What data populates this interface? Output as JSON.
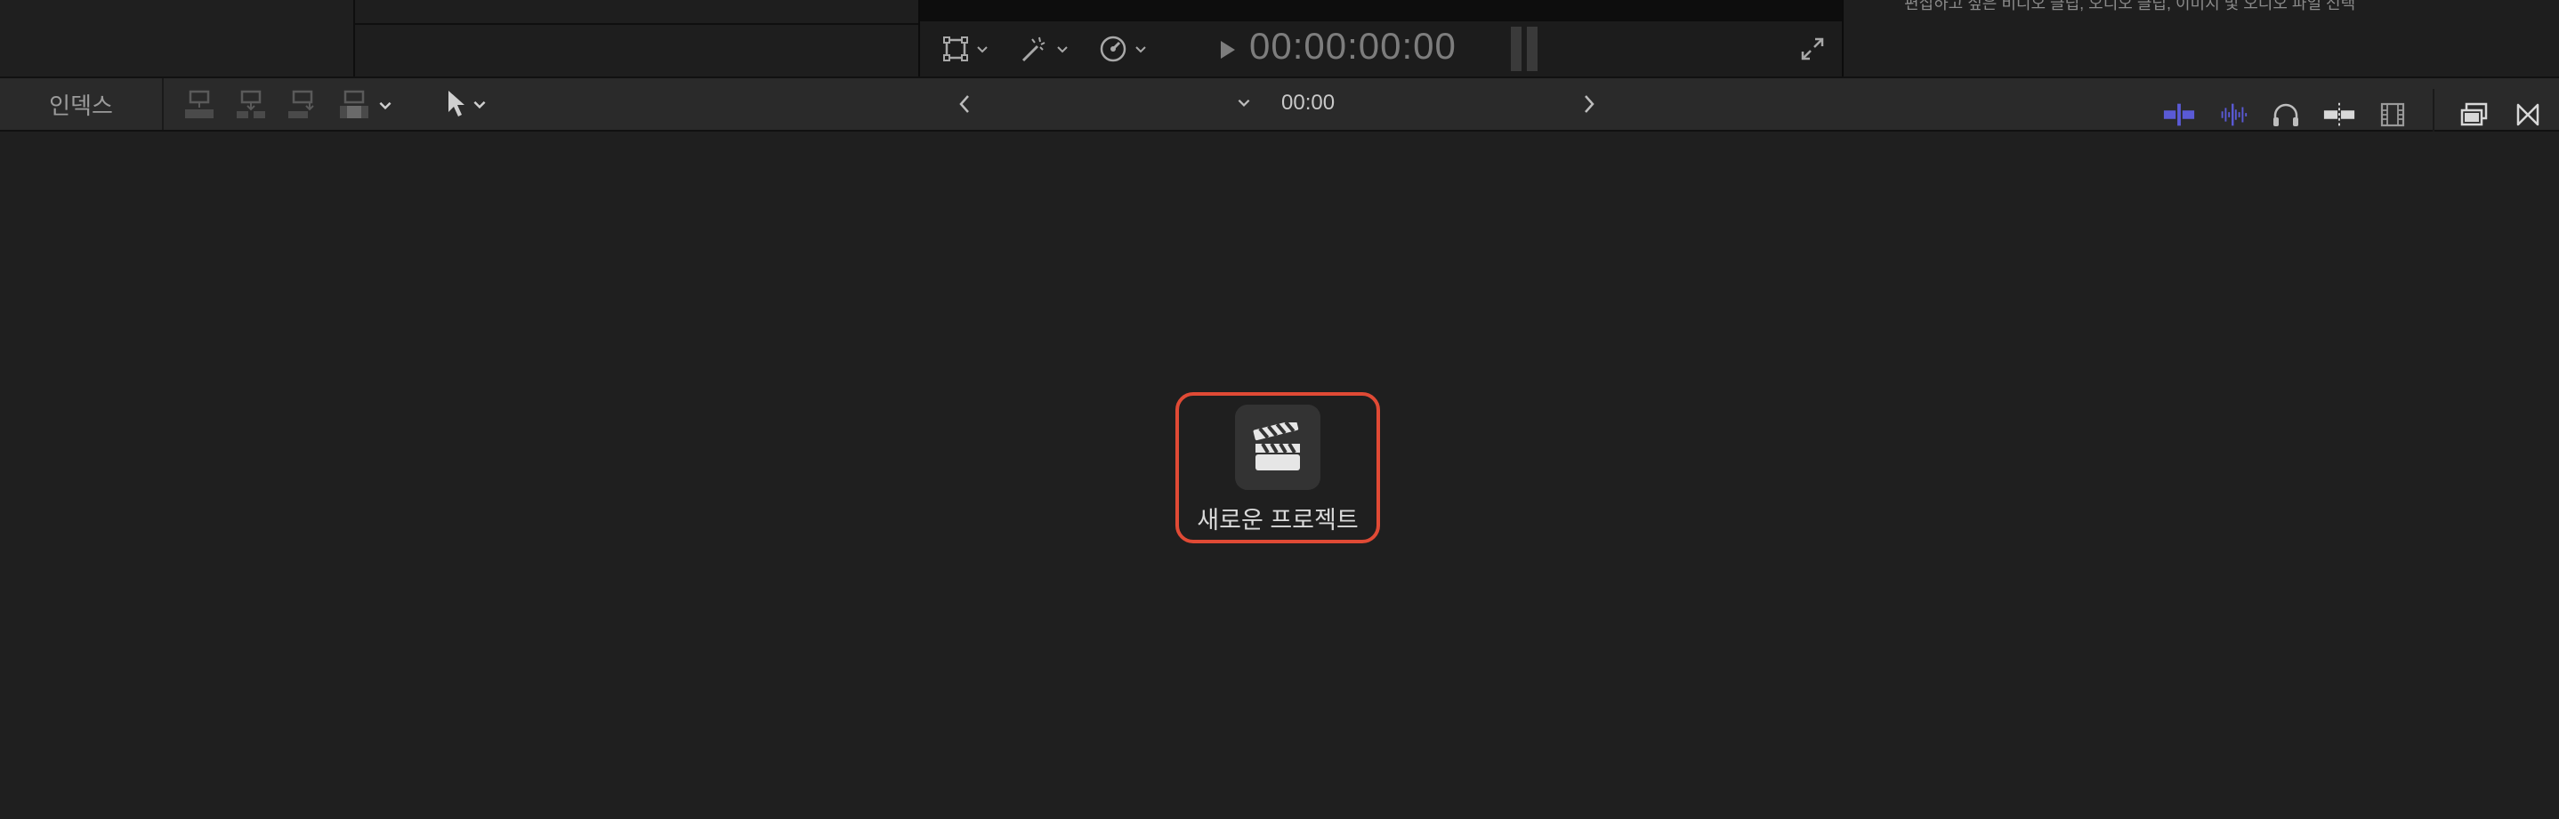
{
  "viewer": {
    "timecode": "00:00:00:00"
  },
  "inspector": {
    "hint": "편집하고 싶은 비디오 클립, 오디오 클립, 이미지 및 오디오 파일 선택"
  },
  "toolbar": {
    "index_label": "인덱스",
    "duration": "00:00"
  },
  "timeline": {
    "new_project_label": "새로운 프로젝트"
  },
  "colors": {
    "highlight_border": "#e04a35",
    "audio_tool_accent": "#5a5ad6"
  },
  "icons": {
    "viewer_controls": [
      "transform-icon",
      "magic-wand-icon",
      "speedometer-icon",
      "play-icon",
      "fullscreen-icon"
    ],
    "edit_tools": [
      "connect-clip-icon",
      "insert-clip-icon",
      "append-clip-icon",
      "overwrite-clip-icon"
    ],
    "right_tools": [
      "skimming-icon",
      "audio-skimming-icon",
      "solo-icon",
      "snapping-icon",
      "clip-appearance-icon",
      "timeline-history-icon",
      "effects-browser-icon"
    ],
    "new_project": "clapperboard-icon"
  }
}
